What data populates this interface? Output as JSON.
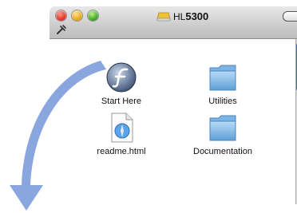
{
  "window": {
    "title_prefix": "HL",
    "title_model": "5300"
  },
  "items": [
    {
      "label": "Start Here",
      "icon": "flash-start-here-icon"
    },
    {
      "label": "Utilities",
      "icon": "folder-icon"
    },
    {
      "label": "readme.html",
      "icon": "html-document-icon"
    },
    {
      "label": "Documentation",
      "icon": "folder-icon"
    }
  ],
  "colors": {
    "arrow": "#8aa6de",
    "folder": "#8ec3ee",
    "scroll_thumb": "#6b99d8"
  }
}
